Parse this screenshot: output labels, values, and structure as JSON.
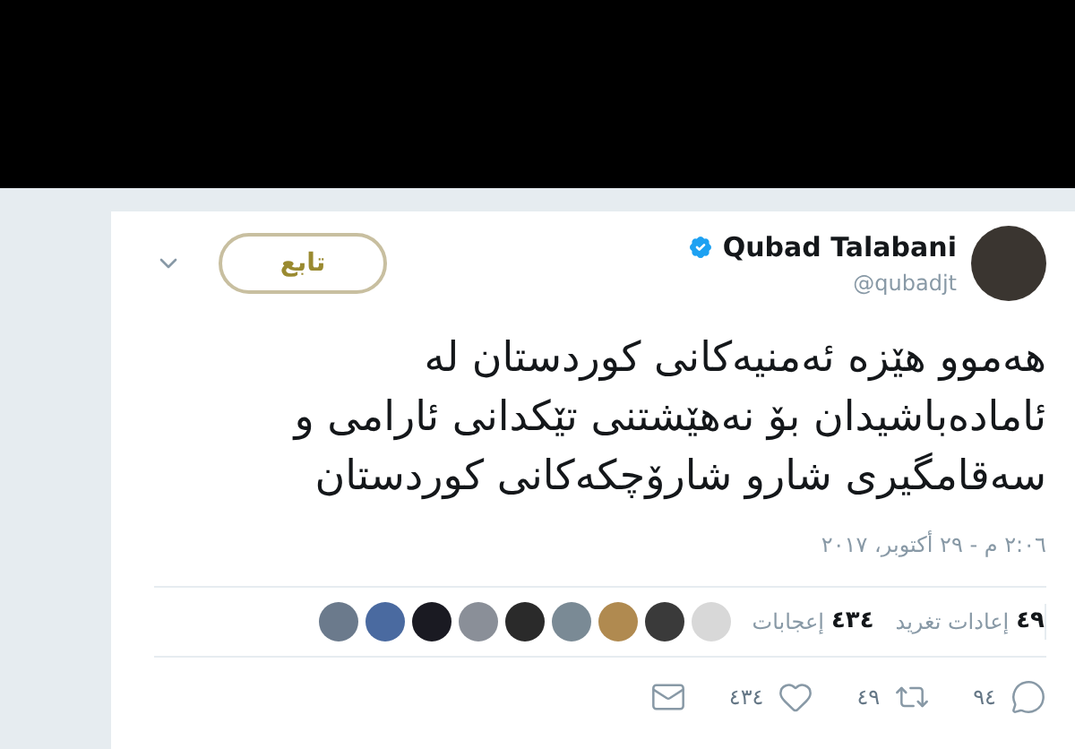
{
  "tweet": {
    "author": {
      "name": "Qubad Talabani",
      "handle": "@qubadjt",
      "verified": true
    },
    "follow_button": {
      "label": "تابع"
    },
    "text_lines": [
      "هەموو هێزە ئەمنیەکانی کوردستان لە",
      "ئامادەباشیدان بۆ نەهێشتنی تێکدانی ئارامی و",
      "سەقامگیری شارو شارۆچکەکانی کوردستان"
    ],
    "timestamp": "٢:٠٦ م - ٢٩ أكتوبر، ٢٠١٧",
    "stats": [
      {
        "count": "٤٩",
        "label": "إعادات تغريد"
      },
      {
        "count": "٤٣٤",
        "label": "إعجابات"
      }
    ],
    "actions": [
      {
        "kind": "reply",
        "count": "٩٤"
      },
      {
        "kind": "retweet",
        "count": "٤٩"
      },
      {
        "kind": "like",
        "count": "٤٣٤"
      },
      {
        "kind": "message"
      }
    ]
  }
}
